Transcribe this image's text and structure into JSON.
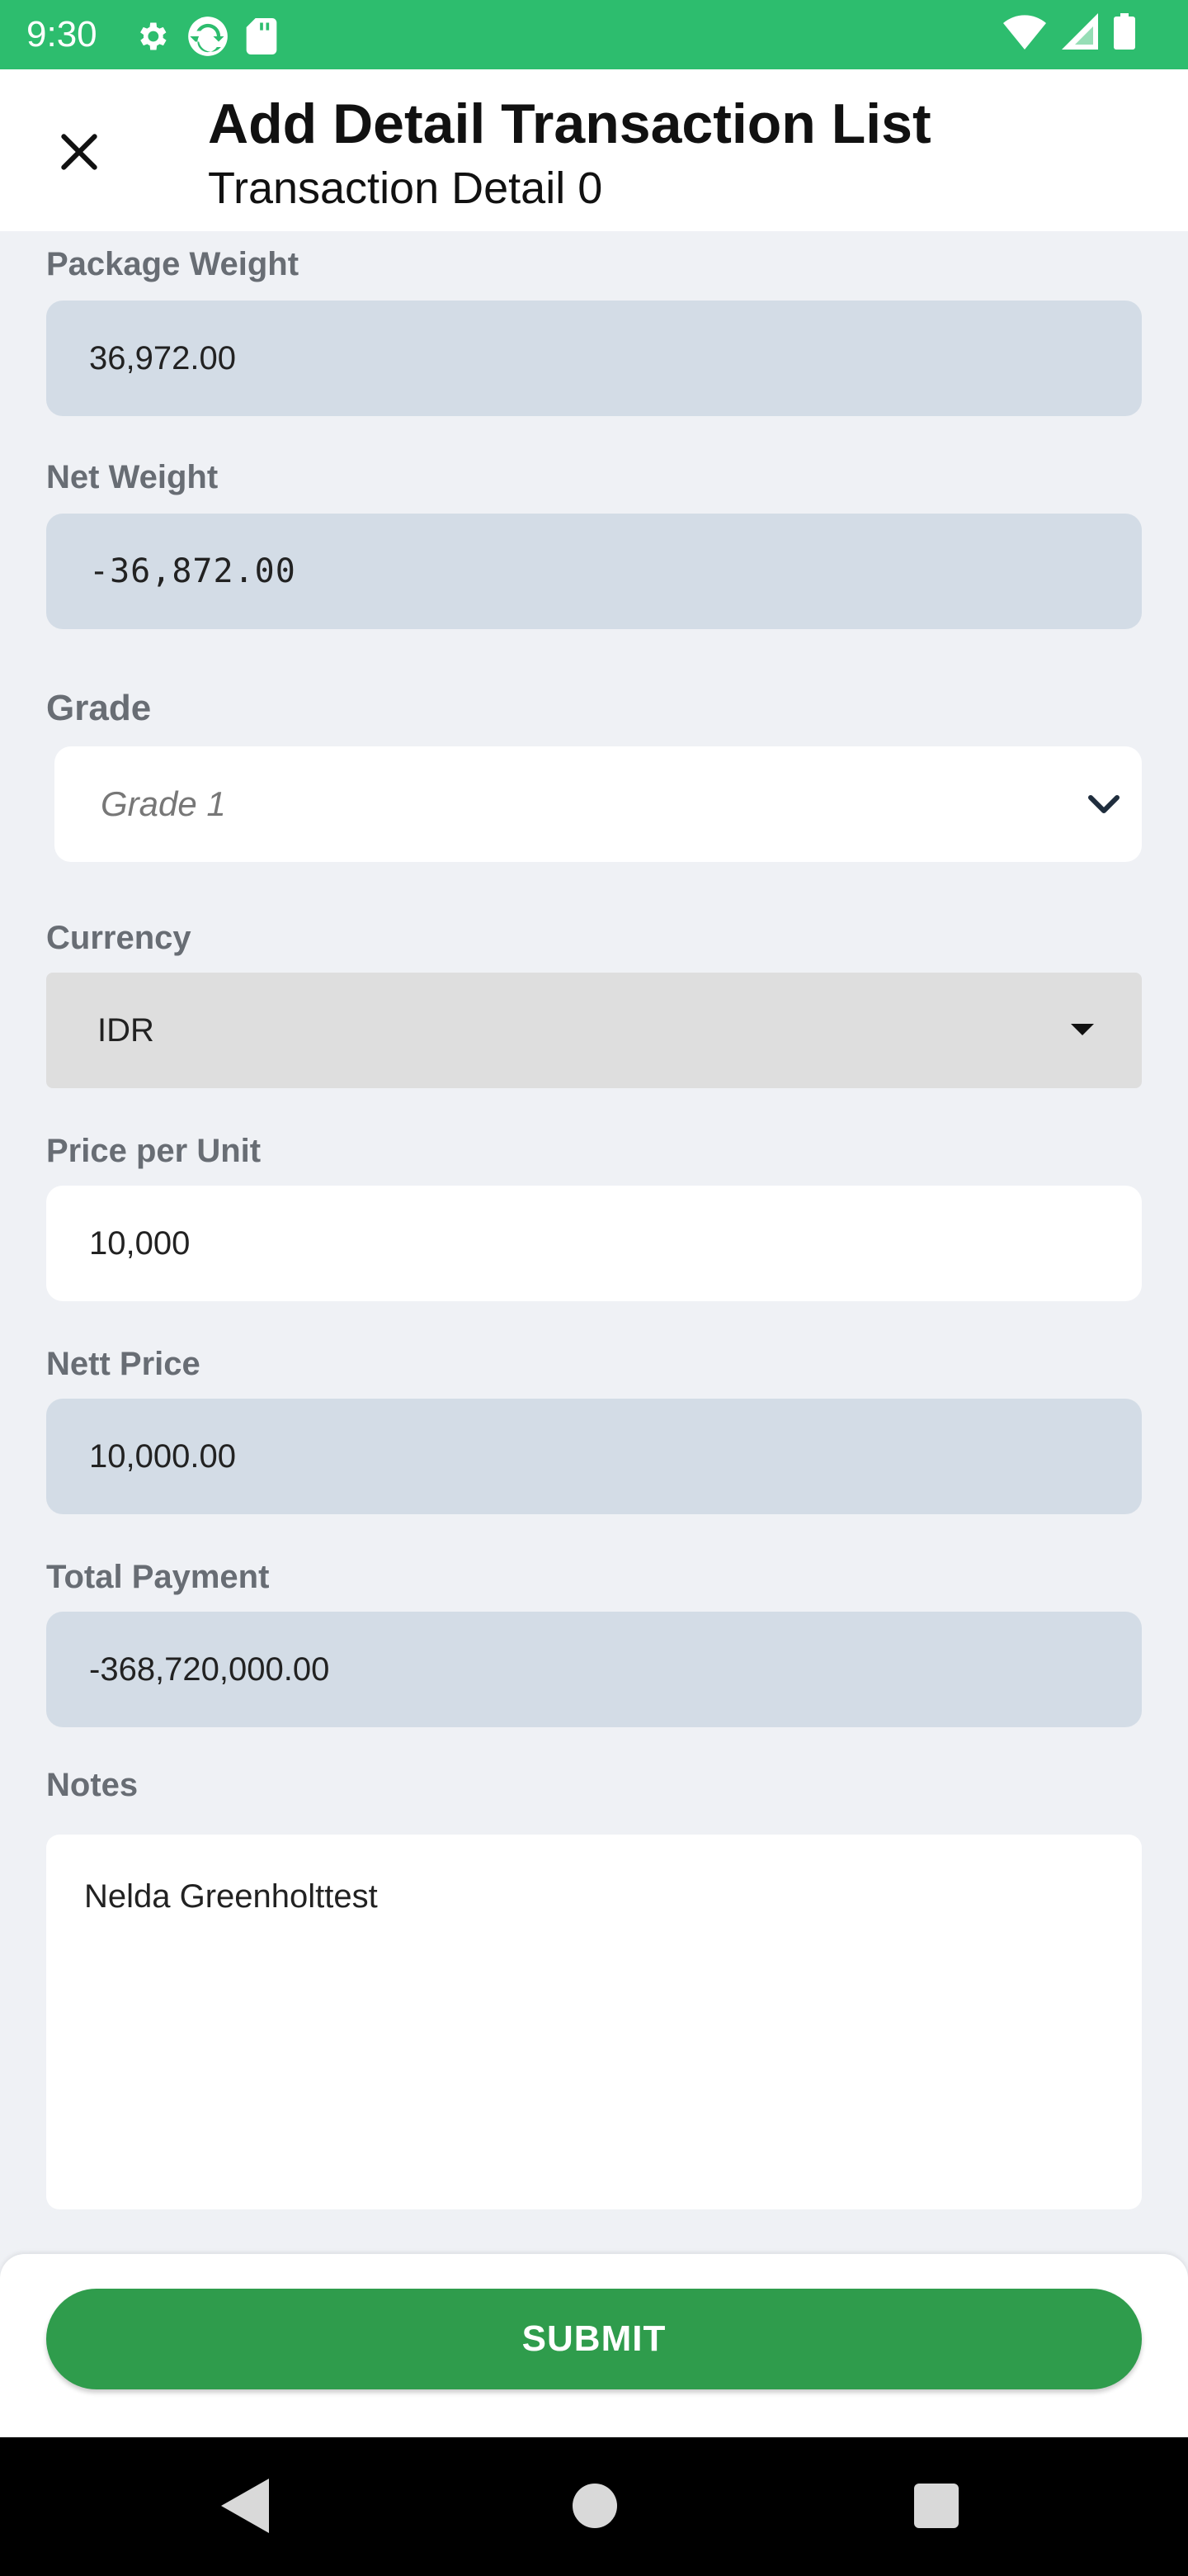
{
  "status_bar": {
    "time": "9:30",
    "icons_left": [
      "gear-icon",
      "sync-icon",
      "sd-card-icon"
    ],
    "icons_right": [
      "wifi-icon",
      "signal-icon",
      "battery-icon"
    ],
    "color": "#2dbd6e"
  },
  "app_bar": {
    "title": "Add Detail Transaction List",
    "subtitle": "Transaction Detail 0",
    "close_icon": "close-icon"
  },
  "form": {
    "package_weight": {
      "label": "Package Weight",
      "value": "36,972.00"
    },
    "net_weight": {
      "label": "Net Weight",
      "value": "-36,872.00"
    },
    "grade": {
      "label": "Grade",
      "selected": "Grade 1"
    },
    "currency": {
      "label": "Currency",
      "selected": "IDR"
    },
    "price_per_unit": {
      "label": "Price per Unit",
      "value": "10,000"
    },
    "nett_price": {
      "label": "Nett Price",
      "value": "10,000.00"
    },
    "total_payment": {
      "label": "Total Payment",
      "value": "-368,720,000.00"
    },
    "notes": {
      "label": "Notes",
      "value": "Nelda Greenholttest"
    }
  },
  "submit": {
    "label": "SUBMIT",
    "color": "#2f9c4c"
  },
  "nav_bar": {
    "icons": [
      "back-icon",
      "home-icon",
      "recents-icon"
    ]
  }
}
